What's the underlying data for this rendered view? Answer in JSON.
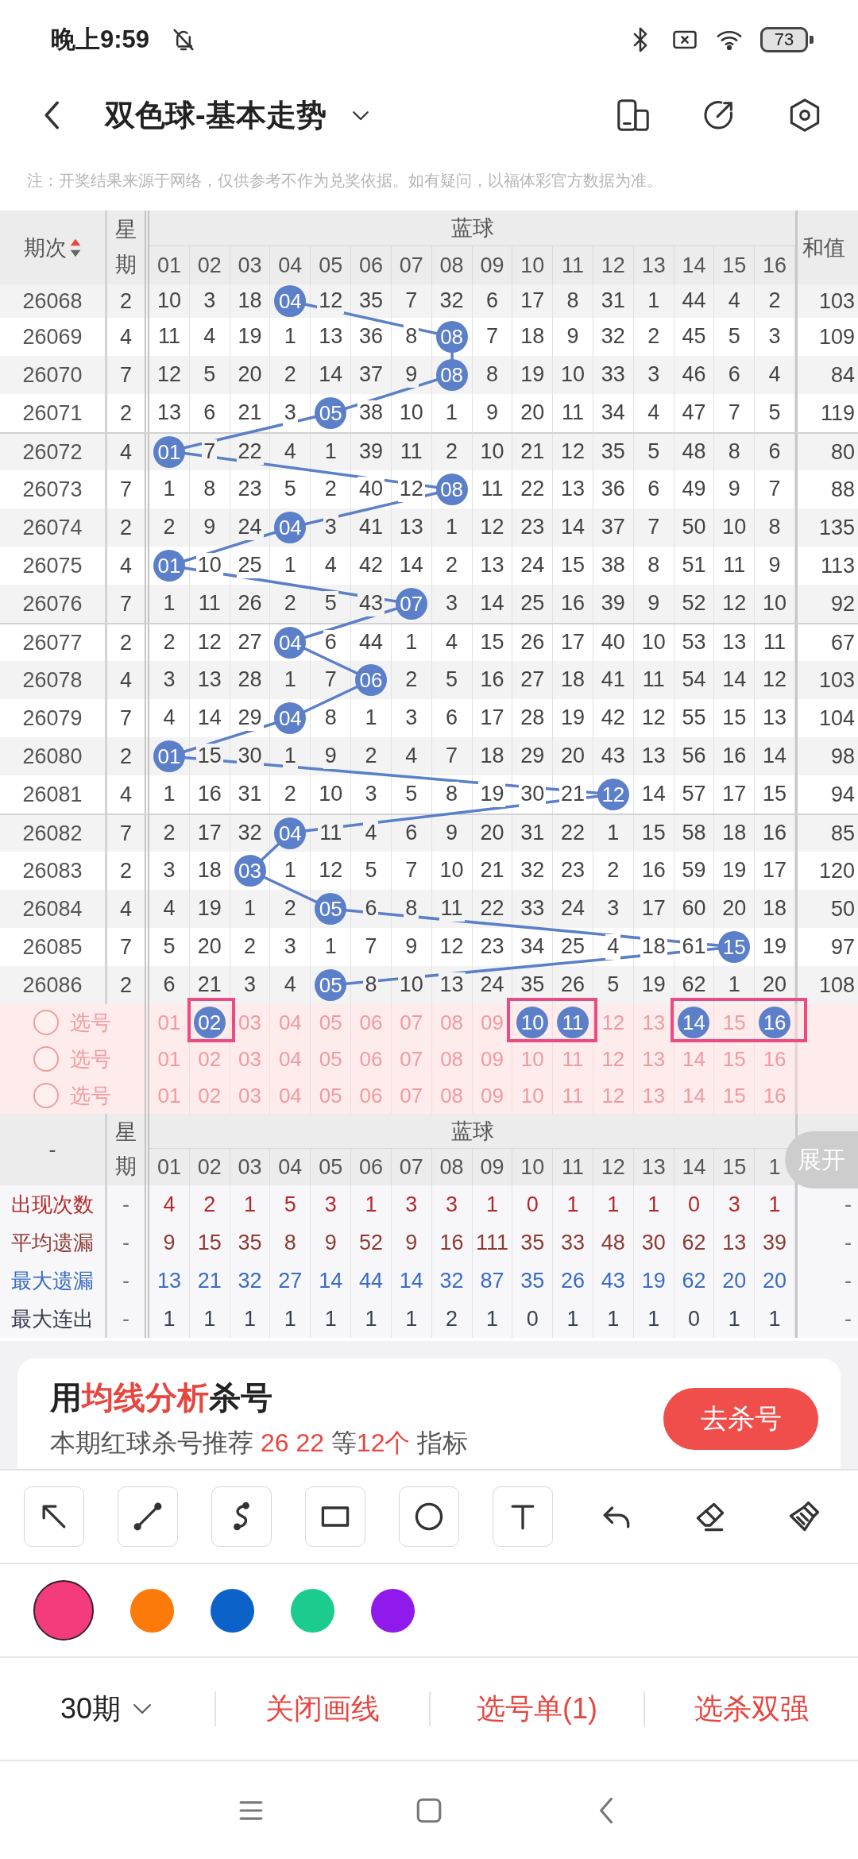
{
  "status_bar": {
    "time": "晚上9:59",
    "battery": "73"
  },
  "header": {
    "title": "双色球-基本走势"
  },
  "note": "注：开奖结果来源于网络，仅供参考不作为兑奖依据。如有疑问，以福体彩官方数据为准。",
  "table": {
    "period_heading": "期次",
    "sort_ascending": true,
    "weekday_heading": "星期",
    "group_heading": "蓝球",
    "sum_heading": "和值",
    "columns": [
      "01",
      "02",
      "03",
      "04",
      "05",
      "06",
      "07",
      "08",
      "09",
      "10",
      "11",
      "12",
      "13",
      "14",
      "15",
      "16"
    ],
    "rows": [
      {
        "period": "26068",
        "weekday": "2",
        "cells": [
          "10",
          "3",
          "18",
          {
            "text": "04",
            "hit": true
          },
          "12",
          "35",
          "7",
          "32",
          "6",
          "17",
          "8",
          "31",
          "1",
          "44",
          "4",
          "2"
        ],
        "sum": "103"
      },
      {
        "period": "26069",
        "weekday": "4",
        "cells": [
          "11",
          "4",
          "19",
          "1",
          "13",
          "36",
          "8",
          {
            "text": "08",
            "hit": true
          },
          "7",
          "18",
          "9",
          "32",
          "2",
          "45",
          "5",
          "3"
        ],
        "sum": "109"
      },
      {
        "period": "26070",
        "weekday": "7",
        "cells": [
          "12",
          "5",
          "20",
          "2",
          "14",
          "37",
          "9",
          {
            "text": "08",
            "hit": true
          },
          "8",
          "19",
          "10",
          "33",
          "3",
          "46",
          "6",
          "4"
        ],
        "sum": "84"
      },
      {
        "period": "26071",
        "weekday": "2",
        "cells": [
          "13",
          "6",
          "21",
          "3",
          {
            "text": "05",
            "hit": true
          },
          "38",
          "10",
          "1",
          "9",
          "20",
          "11",
          "34",
          "4",
          "47",
          "7",
          "5"
        ],
        "sum": "119"
      },
      {
        "period": "26072",
        "weekday": "4",
        "cells": [
          {
            "text": "01",
            "hit": true
          },
          "7",
          "22",
          "4",
          "1",
          "39",
          "11",
          "2",
          "10",
          "21",
          "12",
          "35",
          "5",
          "48",
          "8",
          "6"
        ],
        "sum": "80"
      },
      {
        "period": "26073",
        "weekday": "7",
        "cells": [
          "1",
          "8",
          "23",
          "5",
          "2",
          "40",
          "12",
          {
            "text": "08",
            "hit": true
          },
          "11",
          "22",
          "13",
          "36",
          "6",
          "49",
          "9",
          "7"
        ],
        "sum": "88"
      },
      {
        "period": "26074",
        "weekday": "2",
        "cells": [
          "2",
          "9",
          "24",
          {
            "text": "04",
            "hit": true
          },
          "3",
          "41",
          "13",
          "1",
          "12",
          "23",
          "14",
          "37",
          "7",
          "50",
          "10",
          "8"
        ],
        "sum": "135"
      },
      {
        "period": "26075",
        "weekday": "4",
        "cells": [
          {
            "text": "01",
            "hit": true
          },
          "10",
          "25",
          "1",
          "4",
          "42",
          "14",
          "2",
          "13",
          "24",
          "15",
          "38",
          "8",
          "51",
          "11",
          "9"
        ],
        "sum": "113"
      },
      {
        "period": "26076",
        "weekday": "7",
        "cells": [
          "1",
          "11",
          "26",
          "2",
          "5",
          "43",
          {
            "text": "07",
            "hit": true
          },
          "3",
          "14",
          "25",
          "16",
          "39",
          "9",
          "52",
          "12",
          "10"
        ],
        "sum": "92"
      },
      {
        "period": "26077",
        "weekday": "2",
        "cells": [
          "2",
          "12",
          "27",
          {
            "text": "04",
            "hit": true
          },
          "6",
          "44",
          "1",
          "4",
          "15",
          "26",
          "17",
          "40",
          "10",
          "53",
          "13",
          "11"
        ],
        "sum": "67"
      },
      {
        "period": "26078",
        "weekday": "4",
        "cells": [
          "3",
          "13",
          "28",
          "1",
          "7",
          {
            "text": "06",
            "hit": true
          },
          "2",
          "5",
          "16",
          "27",
          "18",
          "41",
          "11",
          "54",
          "14",
          "12"
        ],
        "sum": "103"
      },
      {
        "period": "26079",
        "weekday": "7",
        "cells": [
          "4",
          "14",
          "29",
          {
            "text": "04",
            "hit": true
          },
          "8",
          "1",
          "3",
          "6",
          "17",
          "28",
          "19",
          "42",
          "12",
          "55",
          "15",
          "13"
        ],
        "sum": "104"
      },
      {
        "period": "26080",
        "weekday": "2",
        "cells": [
          {
            "text": "01",
            "hit": true
          },
          "15",
          "30",
          "1",
          "9",
          "2",
          "4",
          "7",
          "18",
          "29",
          "20",
          "43",
          "13",
          "56",
          "16",
          "14"
        ],
        "sum": "98"
      },
      {
        "period": "26081",
        "weekday": "4",
        "cells": [
          "1",
          "16",
          "31",
          "2",
          "10",
          "3",
          "5",
          "8",
          "19",
          "30",
          "21",
          {
            "text": "12",
            "hit": true
          },
          "14",
          "57",
          "17",
          "15"
        ],
        "sum": "94"
      },
      {
        "period": "26082",
        "weekday": "7",
        "cells": [
          "2",
          "17",
          "32",
          {
            "text": "04",
            "hit": true
          },
          "11",
          "4",
          "6",
          "9",
          "20",
          "31",
          "22",
          "1",
          "15",
          "58",
          "18",
          "16"
        ],
        "sum": "85"
      },
      {
        "period": "26083",
        "weekday": "2",
        "cells": [
          "3",
          "18",
          {
            "text": "03",
            "hit": true
          },
          "1",
          "12",
          "5",
          "7",
          "10",
          "21",
          "32",
          "23",
          "2",
          "16",
          "59",
          "19",
          "17"
        ],
        "sum": "120"
      },
      {
        "period": "26084",
        "weekday": "4",
        "cells": [
          "4",
          "19",
          "1",
          "2",
          {
            "text": "05",
            "hit": true
          },
          "6",
          "8",
          "11",
          "22",
          "33",
          "24",
          "3",
          "17",
          "60",
          "20",
          "18"
        ],
        "sum": "50"
      },
      {
        "period": "26085",
        "weekday": "7",
        "cells": [
          "5",
          "20",
          "2",
          "3",
          "1",
          "7",
          "9",
          "12",
          "23",
          "34",
          "25",
          "4",
          "18",
          "61",
          {
            "text": "15",
            "hit": true
          },
          "19"
        ],
        "sum": "97"
      },
      {
        "period": "26086",
        "weekday": "2",
        "cells": [
          "6",
          "21",
          "3",
          "4",
          {
            "text": "05",
            "hit": true
          },
          "8",
          "10",
          "13",
          "24",
          "35",
          "26",
          "5",
          "19",
          "62",
          "1",
          "20"
        ],
        "sum": "108"
      }
    ],
    "picks": [
      {
        "checked": false,
        "label": "选号",
        "numbers": [
          {
            "text": "01",
            "selected": false
          },
          {
            "text": "02",
            "selected": true
          },
          {
            "text": "03",
            "selected": false
          },
          {
            "text": "04",
            "selected": false
          },
          {
            "text": "05",
            "selected": false
          },
          {
            "text": "06",
            "selected": false
          },
          {
            "text": "07",
            "selected": false
          },
          {
            "text": "08",
            "selected": false
          },
          {
            "text": "09",
            "selected": false
          },
          {
            "text": "10",
            "selected": true
          },
          {
            "text": "11",
            "selected": true
          },
          {
            "text": "12",
            "selected": false
          },
          {
            "text": "13",
            "selected": false
          },
          {
            "text": "14",
            "selected": true
          },
          {
            "text": "15",
            "selected": false
          },
          {
            "text": "16",
            "selected": true
          }
        ]
      },
      {
        "checked": false,
        "label": "选号",
        "numbers": [
          {
            "text": "01",
            "selected": false
          },
          {
            "text": "02",
            "selected": false
          },
          {
            "text": "03",
            "selected": false
          },
          {
            "text": "04",
            "selected": false
          },
          {
            "text": "05",
            "selected": false
          },
          {
            "text": "06",
            "selected": false
          },
          {
            "text": "07",
            "selected": false
          },
          {
            "text": "08",
            "selected": false
          },
          {
            "text": "09",
            "selected": false
          },
          {
            "text": "10",
            "selected": false
          },
          {
            "text": "11",
            "selected": false
          },
          {
            "text": "12",
            "selected": false
          },
          {
            "text": "13",
            "selected": false
          },
          {
            "text": "14",
            "selected": false
          },
          {
            "text": "15",
            "selected": false
          },
          {
            "text": "16",
            "selected": false
          }
        ]
      },
      {
        "checked": false,
        "label": "选号",
        "numbers": [
          {
            "text": "01",
            "selected": false
          },
          {
            "text": "02",
            "selected": false
          },
          {
            "text": "03",
            "selected": false
          },
          {
            "text": "04",
            "selected": false
          },
          {
            "text": "05",
            "selected": false
          },
          {
            "text": "06",
            "selected": false
          },
          {
            "text": "07",
            "selected": false
          },
          {
            "text": "08",
            "selected": false
          },
          {
            "text": "09",
            "selected": false
          },
          {
            "text": "10",
            "selected": false
          },
          {
            "text": "11",
            "selected": false
          },
          {
            "text": "12",
            "selected": false
          },
          {
            "text": "13",
            "selected": false
          },
          {
            "text": "14",
            "selected": false
          },
          {
            "text": "15",
            "selected": false
          },
          {
            "text": "16",
            "selected": false
          }
        ]
      }
    ],
    "annotations": [
      {
        "kind": "rectangle"
      },
      {
        "kind": "rectangle"
      },
      {
        "kind": "rectangle"
      }
    ]
  },
  "stats": {
    "period_heading": "-",
    "weekday_heading": "星期",
    "group_heading": "蓝球",
    "columns": [
      "01",
      "02",
      "03",
      "04",
      "05",
      "06",
      "07",
      "08",
      "09",
      "10",
      "11",
      "12",
      "13",
      "14",
      "15",
      "1"
    ],
    "expand_button": "展开",
    "rows": [
      {
        "label": "出现次数",
        "color": "#b3292b",
        "weekday": "-",
        "values": [
          "4",
          "2",
          "1",
          "5",
          "3",
          "1",
          "3",
          "3",
          "1",
          "0",
          "1",
          "1",
          "1",
          "0",
          "3",
          "1"
        ],
        "sum": "-"
      },
      {
        "label": "平均遗漏",
        "color": "#8c3b33",
        "weekday": "-",
        "values": [
          "9",
          "15",
          "35",
          "8",
          "9",
          "52",
          "9",
          "16",
          "111",
          "35",
          "33",
          "48",
          "30",
          "62",
          "13",
          "39"
        ],
        "sum": "-"
      },
      {
        "label": "最大遗漏",
        "color": "#3a6cc4",
        "weekday": "-",
        "values": [
          "13",
          "21",
          "32",
          "27",
          "14",
          "44",
          "14",
          "32",
          "87",
          "35",
          "26",
          "43",
          "19",
          "62",
          "20",
          "20"
        ],
        "sum": "-"
      },
      {
        "label": "最大连出",
        "color": "#3b3f50",
        "weekday": "-",
        "values": [
          "1",
          "1",
          "1",
          "1",
          "1",
          "1",
          "1",
          "2",
          "1",
          "0",
          "1",
          "1",
          "1",
          "0",
          "1",
          "1"
        ],
        "sum": "-"
      }
    ]
  },
  "promo": {
    "title": [
      {
        "text": "用",
        "highlight": false
      },
      {
        "text": "均线分析",
        "highlight": true
      },
      {
        "text": "杀号",
        "highlight": false
      }
    ],
    "subtitle": [
      {
        "text": "本期红球杀号推荐 ",
        "highlight": false
      },
      {
        "text": "26 22",
        "highlight": true
      },
      {
        "text": " 等",
        "highlight": false
      },
      {
        "text": "12个",
        "highlight": true
      },
      {
        "text": " 指标",
        "highlight": false
      }
    ],
    "button": "去杀号"
  },
  "palette": [
    {
      "color": "#f43b7c",
      "selected": true
    },
    {
      "color": "#fb7a0a",
      "selected": false
    },
    {
      "color": "#0b63c9",
      "selected": false
    },
    {
      "color": "#1bcc8e",
      "selected": false
    },
    {
      "color": "#8f1aeb",
      "selected": false
    }
  ],
  "actions": [
    {
      "kind": "dropdown",
      "label": "30期"
    },
    {
      "kind": "link",
      "label": "关闭画线"
    },
    {
      "kind": "link",
      "label": "选号单(1)"
    },
    {
      "kind": "link",
      "label": "选杀双强"
    }
  ]
}
